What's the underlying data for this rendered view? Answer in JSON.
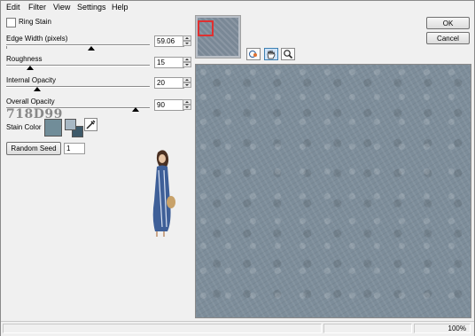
{
  "menu": [
    "Edit",
    "Filter",
    "View",
    "Settings",
    "Help"
  ],
  "ring_stain": {
    "label": "Ring Stain",
    "checked": false
  },
  "controls": [
    {
      "label": "Edge Width (pixels)",
      "value": "59.06",
      "fraction": 0.59
    },
    {
      "label": "Roughness",
      "value": "15",
      "fraction": 0.15
    },
    {
      "label": "Internal Opacity",
      "value": "20",
      "fraction": 0.2
    },
    {
      "label": "Overall Opacity",
      "value": "90",
      "fraction": 0.9
    }
  ],
  "stain_color": {
    "label": "Stain Color",
    "hex_text": "718D99",
    "swatch": "#718d99",
    "fg": "#a8b8c4",
    "bg": "#3e5a6a"
  },
  "random_seed": {
    "label": "Random Seed",
    "value": "1"
  },
  "buttons": {
    "ok": "OK",
    "cancel": "Cancel"
  },
  "preview": {
    "color": "#7d8d9a",
    "thumb_color": "#7a8896"
  },
  "status": {
    "zoom": "100%"
  },
  "icons": {
    "fit": "fit-view-icon",
    "hand": "hand-pan-icon",
    "zoom": "zoom-magnifier-icon",
    "eyedropper": "eyedropper-icon"
  }
}
